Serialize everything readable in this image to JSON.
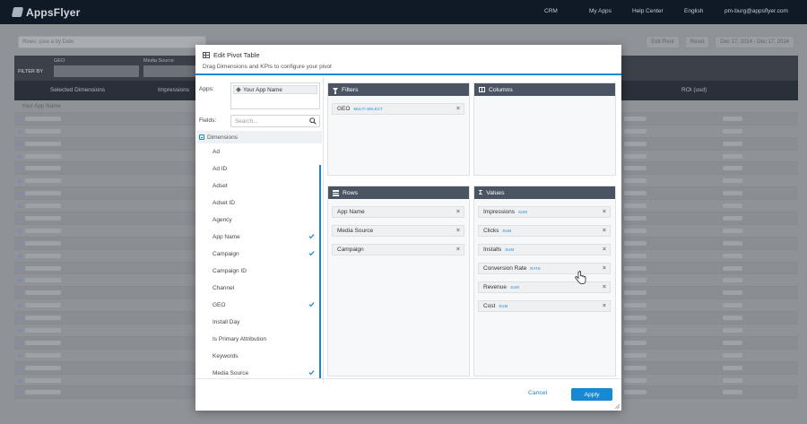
{
  "app": {
    "logo_text": "AppsFlyer",
    "nav": {
      "crm": "CRM",
      "my_apps": "My Apps",
      "help_center": "Help Center",
      "language": "English",
      "user": "pm-burg@appsflyer.com"
    }
  },
  "background": {
    "selector_placeholder": "Rows: (use a by Date",
    "pivot_label": "Edit Pivot",
    "reset_label": "Reset",
    "date_range": "Dec 17, 2014 - Dec 17, 2014",
    "filter_by": "FILTER BY",
    "filter_caps": [
      "GEO",
      "Media Source"
    ],
    "table_headers": [
      "Selected Dimensions",
      "Impressions",
      "ROI (usd)"
    ],
    "first_row": "Your App Name"
  },
  "modal": {
    "title": "Edit Pivot Table",
    "subtitle": "Drag Dimensions and KPIs to configure your pivot",
    "apps_label": "Apps:",
    "selected_app": "Your App Name",
    "fields_label": "Fields:",
    "search_placeholder": "Search...",
    "dimensions_header": "Dimensions",
    "dimensions": [
      {
        "label": "Ad",
        "checked": false
      },
      {
        "label": "Ad ID",
        "checked": false
      },
      {
        "label": "Adset",
        "checked": false
      },
      {
        "label": "Adset ID",
        "checked": false
      },
      {
        "label": "Agency",
        "checked": false
      },
      {
        "label": "App Name",
        "checked": true
      },
      {
        "label": "Campaign",
        "checked": true
      },
      {
        "label": "Campaign ID",
        "checked": false
      },
      {
        "label": "Channel",
        "checked": false
      },
      {
        "label": "GEO",
        "checked": true
      },
      {
        "label": "Install Day",
        "checked": false
      },
      {
        "label": "Is Primary Attribution",
        "checked": false
      },
      {
        "label": "Keywords",
        "checked": false
      },
      {
        "label": "Media Source",
        "checked": true
      }
    ],
    "panels": {
      "filters": {
        "title": "Filters",
        "chips": [
          {
            "label": "GEO",
            "tag": "MULTI-SELECT"
          }
        ]
      },
      "columns": {
        "title": "Columns",
        "chips": []
      },
      "rows": {
        "title": "Rows",
        "chips": [
          {
            "label": "App Name"
          },
          {
            "label": "Media Source"
          },
          {
            "label": "Campaign"
          }
        ]
      },
      "values": {
        "title": "Values",
        "chips": [
          {
            "label": "Impressions",
            "tag": "SUM"
          },
          {
            "label": "Clicks",
            "tag": "SUM"
          },
          {
            "label": "Installs",
            "tag": "SUM"
          },
          {
            "label": "Conversion Rate",
            "tag": "RATE"
          },
          {
            "label": "Revenue",
            "tag": "SUM"
          },
          {
            "label": "Cost",
            "tag": "SUM"
          }
        ]
      }
    },
    "cancel_label": "Cancel",
    "apply_label": "Apply"
  },
  "colors": {
    "accent": "#1588d6",
    "panel_header": "#4a5462",
    "topbar": "#101a26"
  }
}
